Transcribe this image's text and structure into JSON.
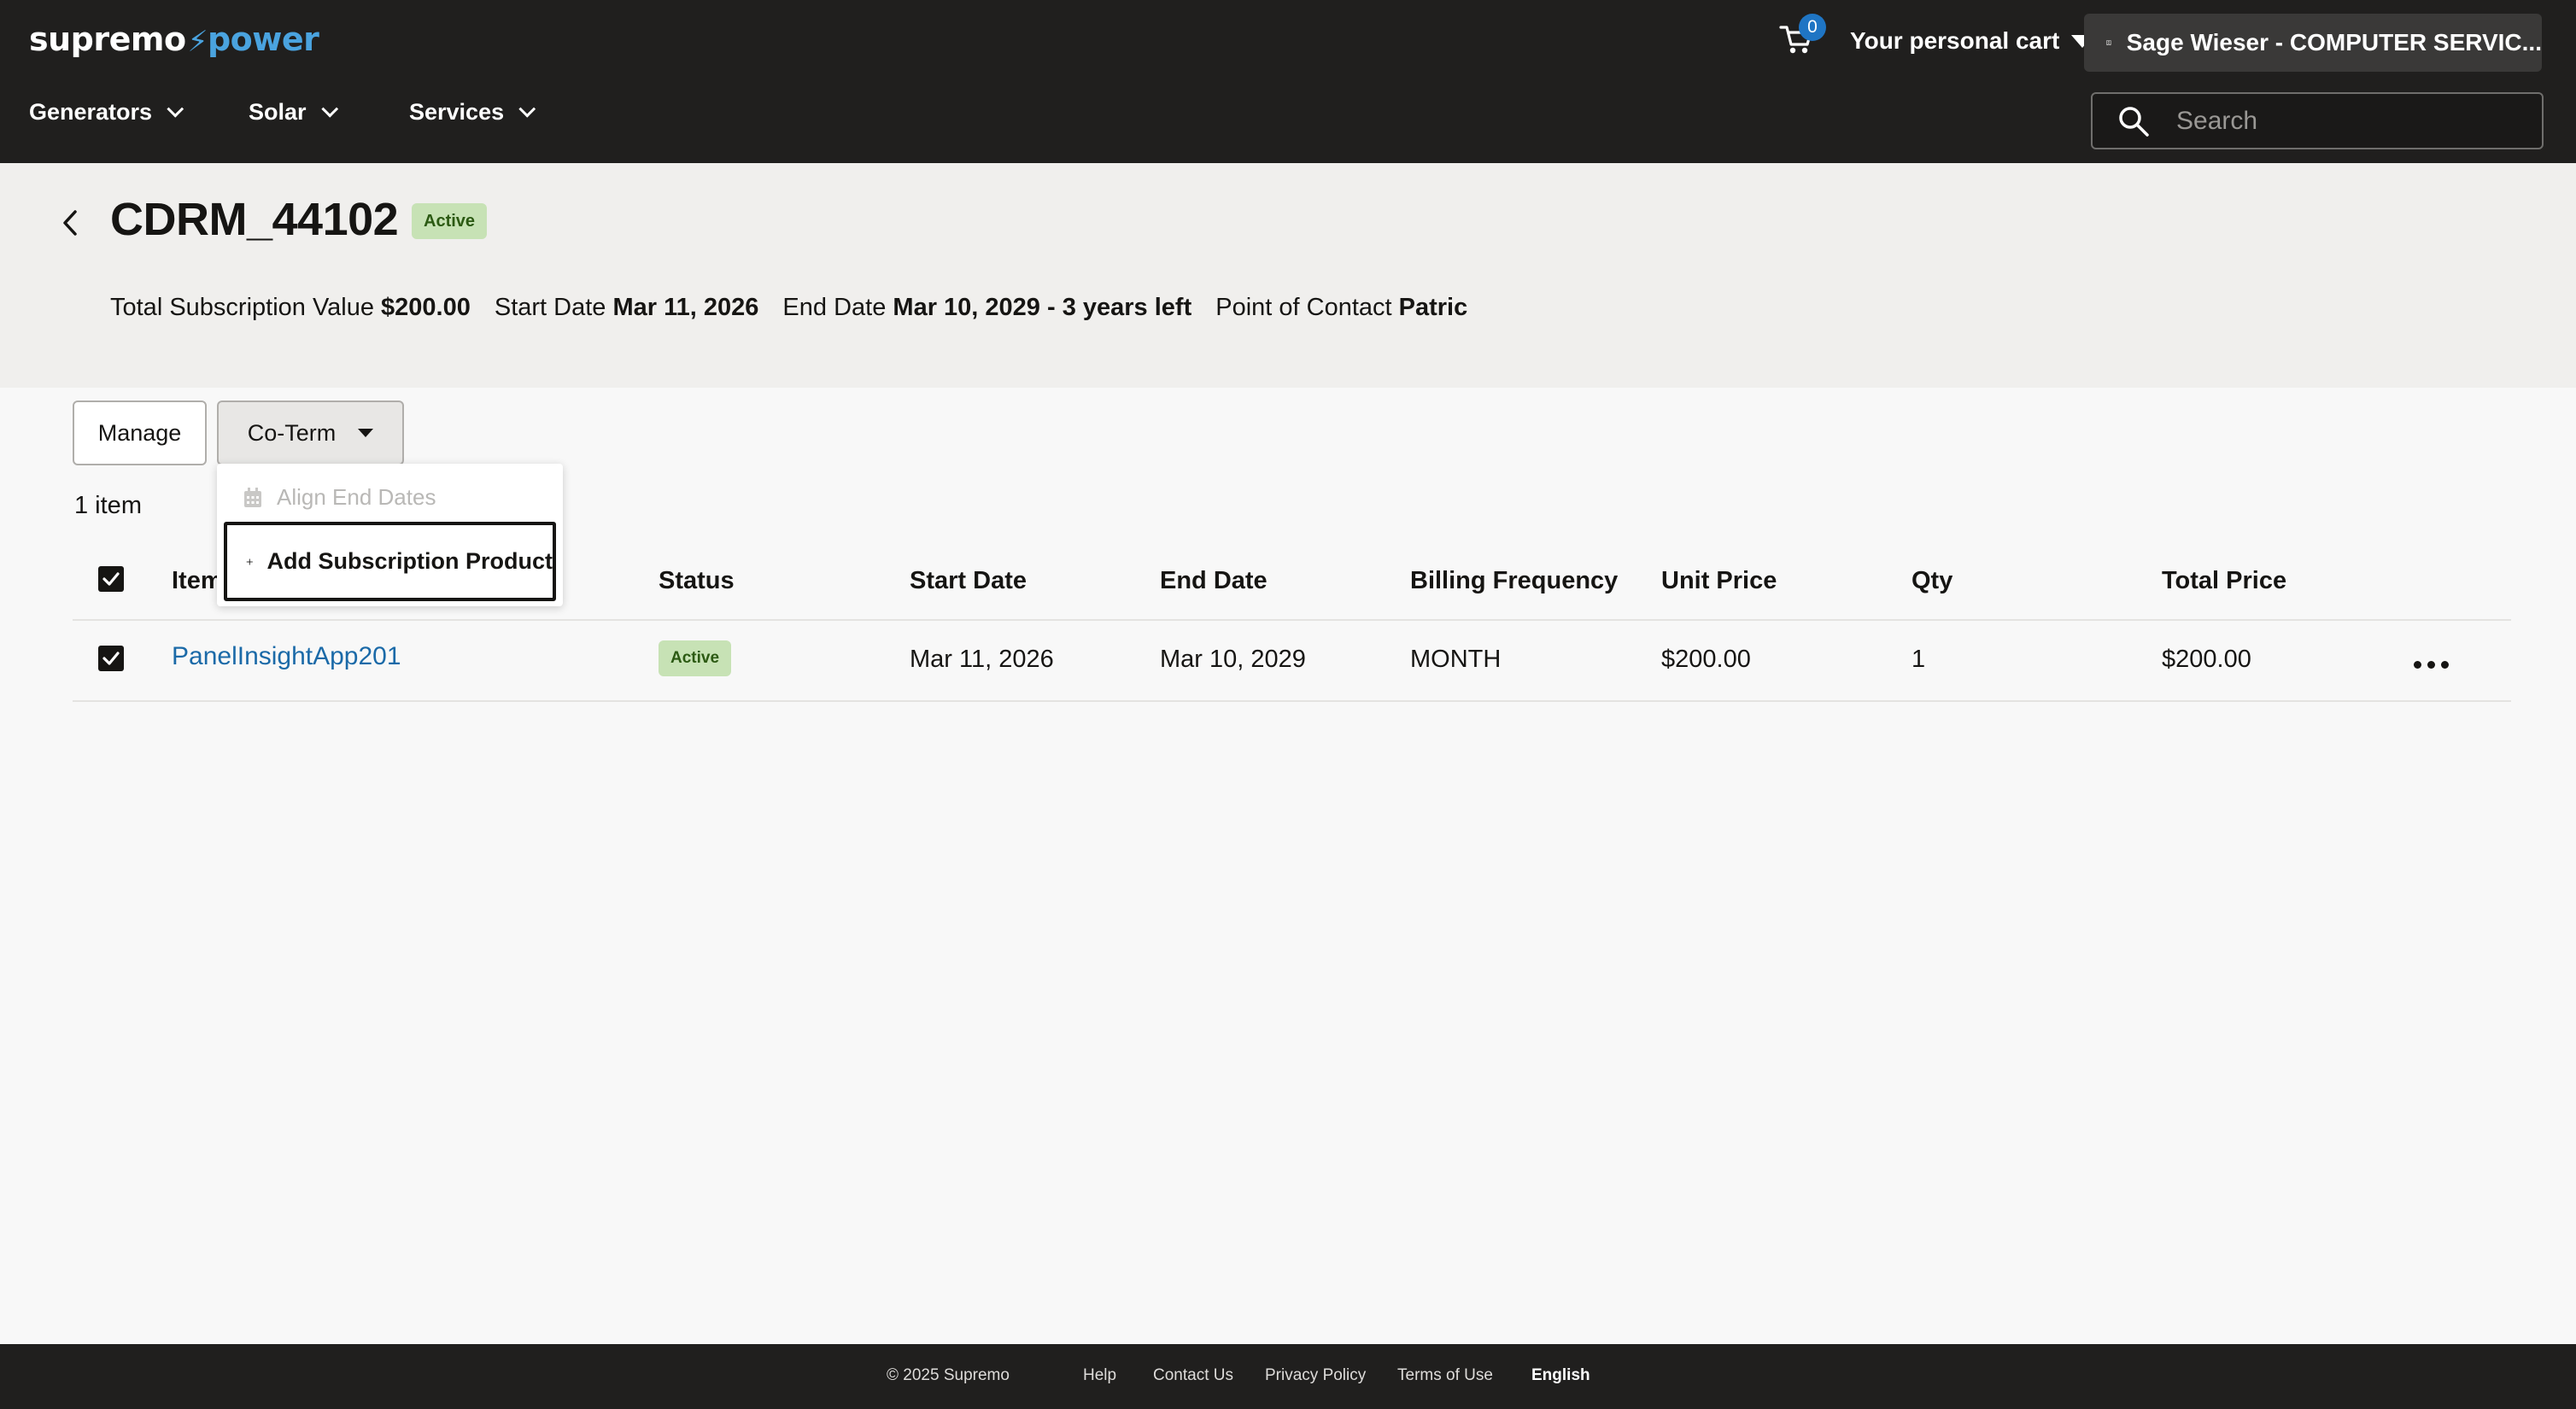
{
  "header": {
    "logo_part1": "supremo",
    "logo_bolt": "⚡",
    "logo_part2": "power",
    "cart_count": "0",
    "cart_label": "Your personal cart",
    "account_name": "Sage Wieser - COMPUTER SERVIC...",
    "nav": [
      {
        "label": "Generators"
      },
      {
        "label": "Solar"
      },
      {
        "label": "Services"
      }
    ],
    "search_placeholder": "Search"
  },
  "subscription": {
    "title": "CDRM_44102",
    "status": "Active",
    "total_value_label": "Total Subscription Value",
    "total_value": "$200.00",
    "start_date_label": "Start Date",
    "start_date": "Mar 11, 2026",
    "end_date_label": "End Date",
    "end_date": "Mar 10, 2029 - 3 years left",
    "contact_label": "Point of Contact",
    "contact": "Patric"
  },
  "actions": {
    "manage_label": "Manage",
    "coterm_label": "Co-Term"
  },
  "coterm_menu": {
    "align_label": "Align End Dates",
    "add_label": "Add Subscription Product"
  },
  "table": {
    "item_count": "1 item",
    "columns": [
      "Item",
      "Status",
      "Start Date",
      "End Date",
      "Billing Frequency",
      "Unit Price",
      "Qty",
      "Total Price"
    ],
    "rows": [
      {
        "item": "PanelInsightApp201",
        "status": "Active",
        "start_date": "Mar 11, 2026",
        "end_date": "Mar 10, 2029",
        "billing_frequency": "MONTH",
        "unit_price": "$200.00",
        "qty": "1",
        "total_price": "$200.00"
      }
    ]
  },
  "footer": {
    "copyright": "© 2025 Supremo",
    "links": [
      "Help",
      "Contact Us",
      "Privacy Policy",
      "Terms of Use"
    ],
    "language": "English"
  },
  "colors": {
    "header_bg": "#201f1e",
    "accent_blue": "#4aa3df",
    "badge_bg": "#c7e2b5",
    "badge_text": "#2c5a13",
    "link": "#1b6aa8"
  }
}
